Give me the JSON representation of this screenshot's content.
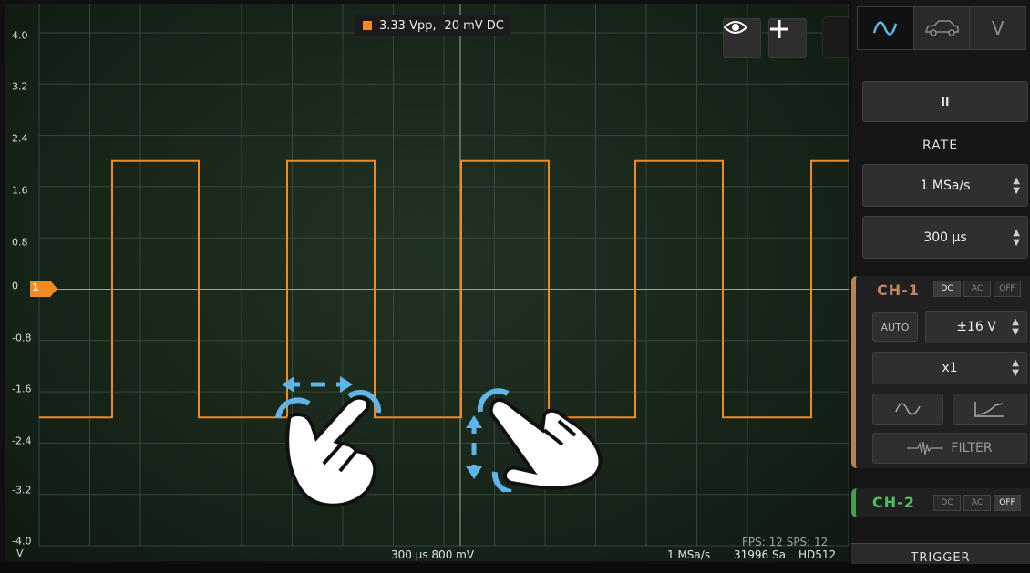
{
  "scope": {
    "measurement": "3.33 Vpp, -20 mV DC",
    "y_labels": [
      "4.0",
      "3.2",
      "2.4",
      "1.6",
      "0.8",
      "0",
      "-0.8",
      "-1.6",
      "-2.4",
      "-3.2",
      "-4.0"
    ],
    "v_unit": "V",
    "channel_marker": "1",
    "bottom_scale": "300 µs  800 mV",
    "bottom_rate": "1 MSa/s",
    "bottom_samples": "31996 Sa",
    "bottom_mode": "HD512",
    "fps": "FPS: 12  SPS: 12",
    "trace_color": "#f08a24",
    "accent": "#5fb4e8"
  },
  "icons": {
    "eye": "eye-icon",
    "plus": "plus-icon",
    "pause": "pause-icon"
  },
  "panel": {
    "tabs": [
      "wave-tab",
      "car-tab",
      "V"
    ],
    "pause_label": "II",
    "rate_label": "RATE",
    "rate_value": "1 MSa/s",
    "timebase_value": "300 µs",
    "ch1": {
      "name": "CH-1",
      "couplings": [
        "DC",
        "AC",
        "OFF"
      ],
      "auto_label": "AUTO",
      "range_value": "±16 V",
      "probe_value": "x1",
      "filter_label": "FILTER"
    },
    "ch2": {
      "name": "CH-2",
      "couplings": [
        "DC",
        "AC",
        "OFF"
      ]
    },
    "trigger_label": "TRIGGER"
  }
}
